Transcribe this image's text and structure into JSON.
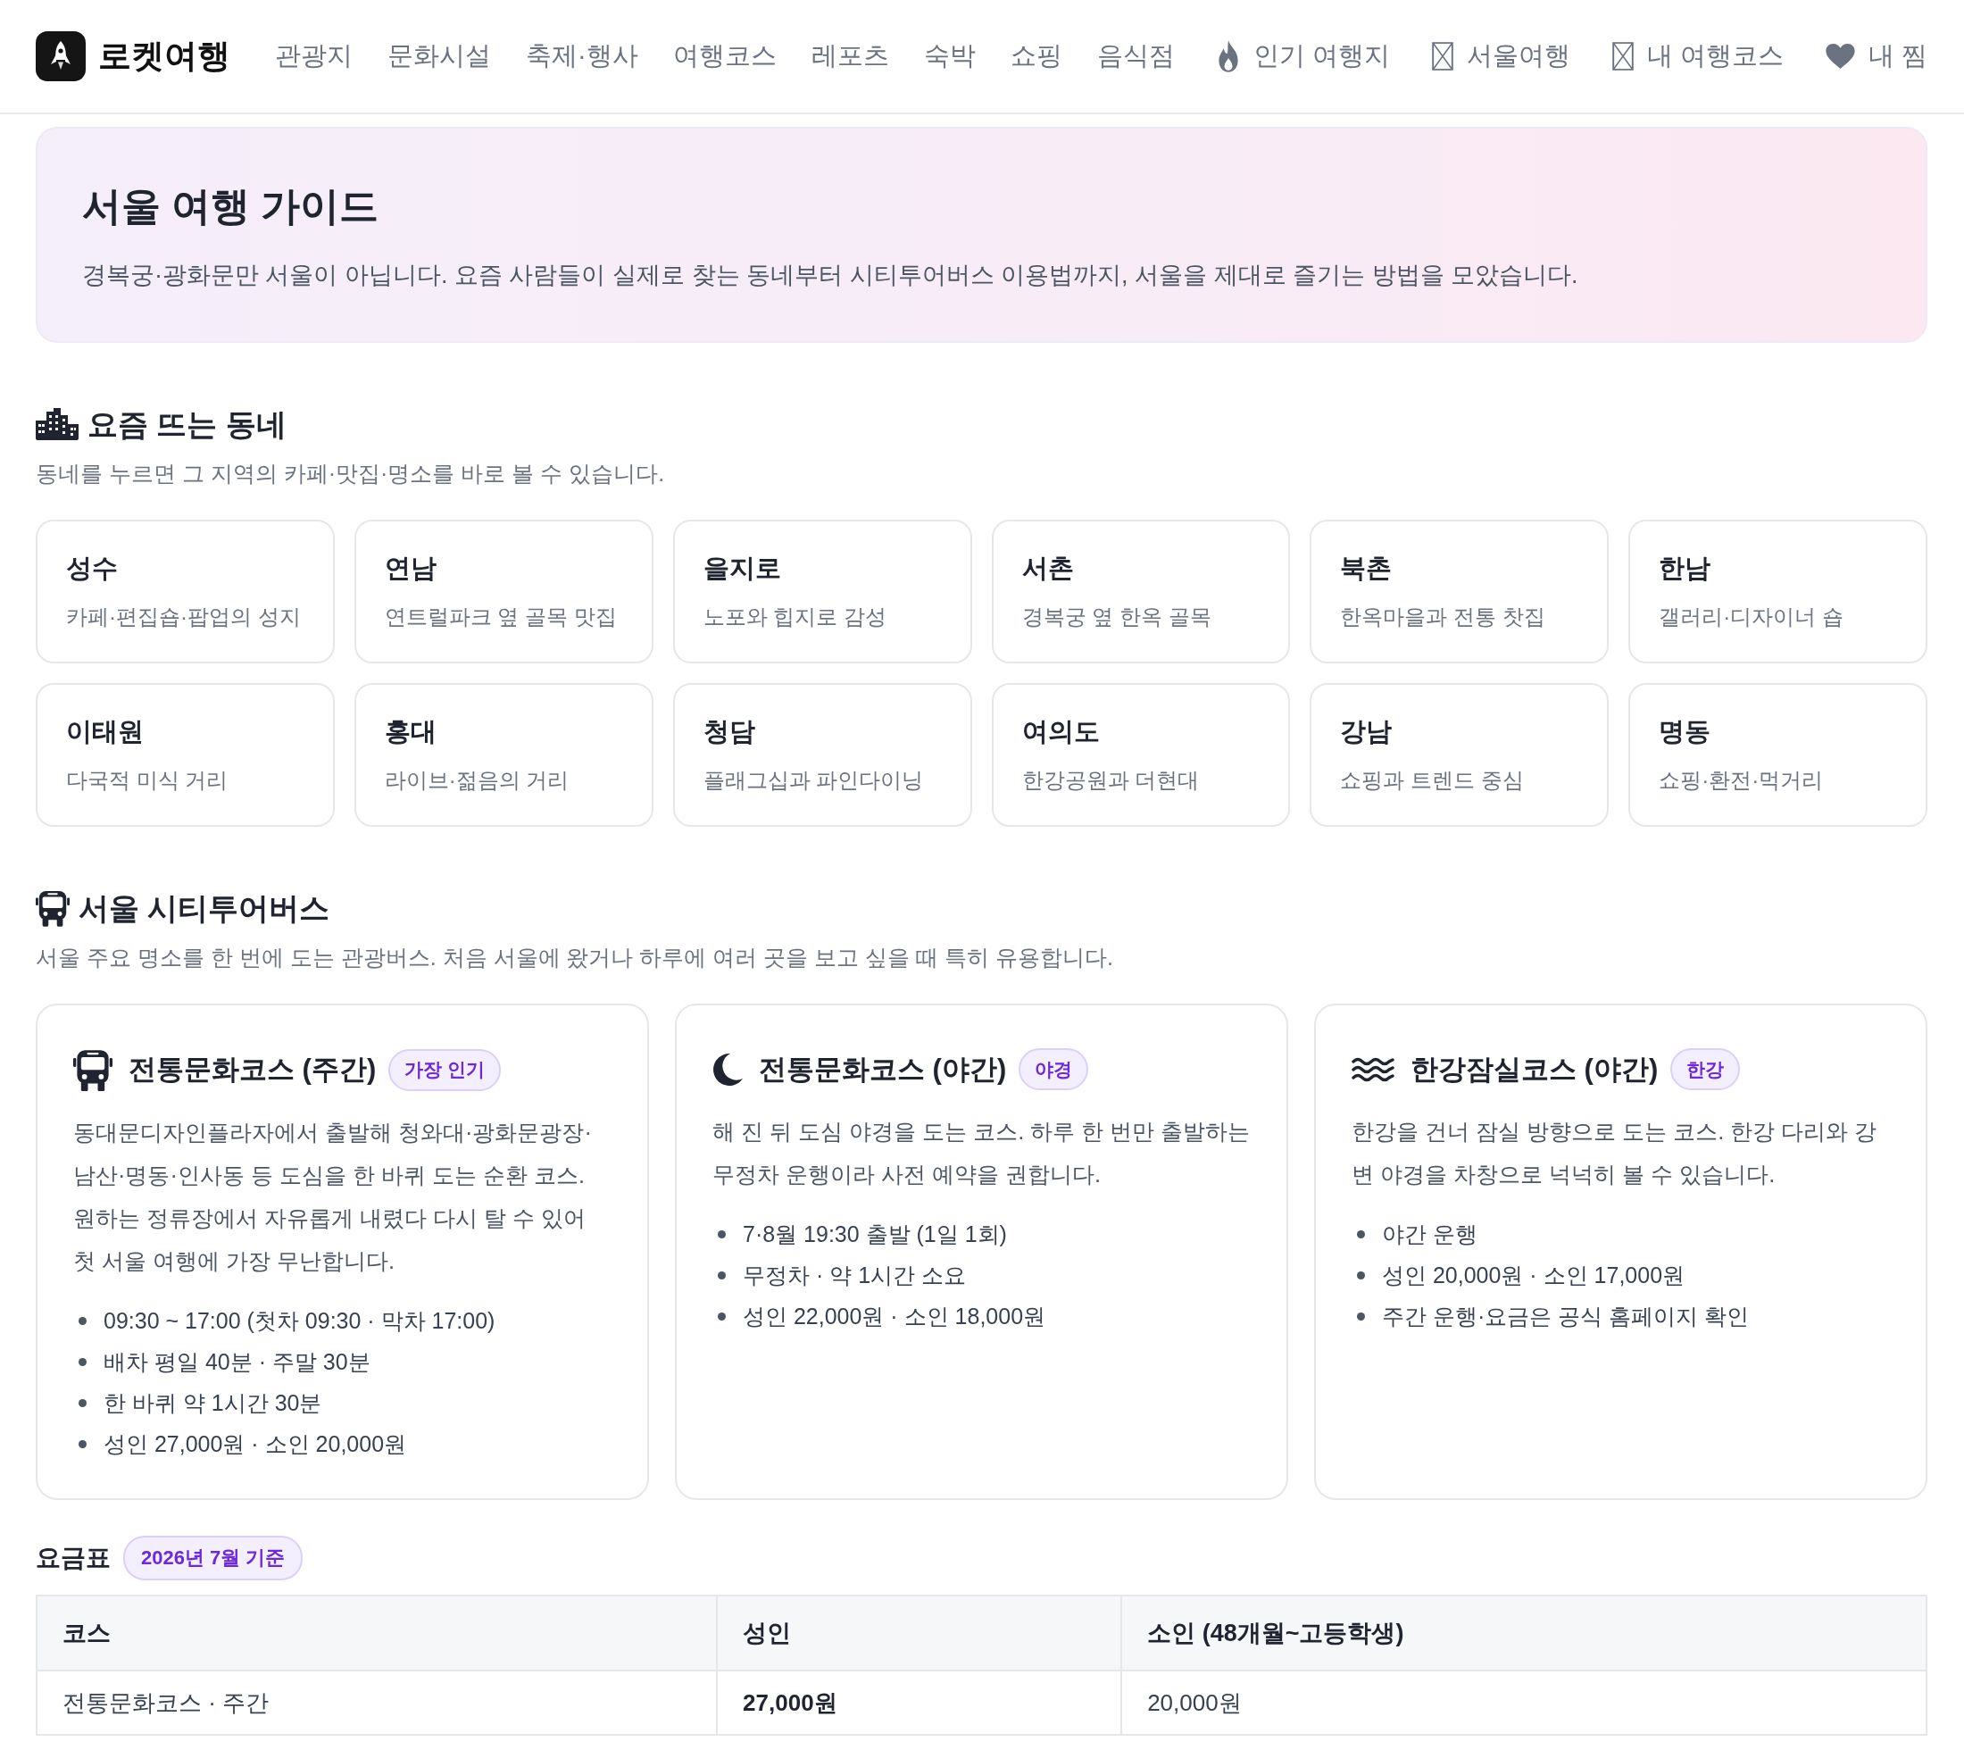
{
  "header": {
    "brand": "로켓여행",
    "nav": [
      {
        "kind": "plain",
        "label": "관광지"
      },
      {
        "kind": "plain",
        "label": "문화시설"
      },
      {
        "kind": "plain",
        "label": "축제·행사"
      },
      {
        "kind": "plain",
        "label": "여행코스"
      },
      {
        "kind": "plain",
        "label": "레포츠"
      },
      {
        "kind": "plain",
        "label": "숙박"
      },
      {
        "kind": "plain",
        "label": "쇼핑"
      },
      {
        "kind": "plain",
        "label": "음식점"
      },
      {
        "kind": "fire",
        "label": "인기 여행지"
      },
      {
        "kind": "box",
        "label": "서울여행"
      },
      {
        "kind": "box",
        "label": "내 여행코스"
      },
      {
        "kind": "heart",
        "label": "내 찜"
      }
    ]
  },
  "hero": {
    "title": "서울 여행 가이드",
    "description": "경복궁·광화문만 서울이 아닙니다. 요즘 사람들이 실제로 찾는 동네부터 시티투어버스 이용법까지, 서울을 제대로 즐기는 방법을 모았습니다."
  },
  "neighborhoods": {
    "title": "요즘 뜨는 동네",
    "description": "동네를 누르면 그 지역의 카페·맛집·명소를 바로 볼 수 있습니다.",
    "items": [
      {
        "name": "성수",
        "tagline": "카페·편집숍·팝업의 성지"
      },
      {
        "name": "연남",
        "tagline": "연트럴파크 옆 골목 맛집"
      },
      {
        "name": "을지로",
        "tagline": "노포와 힙지로 감성"
      },
      {
        "name": "서촌",
        "tagline": "경복궁 옆 한옥 골목"
      },
      {
        "name": "북촌",
        "tagline": "한옥마을과 전통 찻집"
      },
      {
        "name": "한남",
        "tagline": "갤러리·디자이너 숍"
      },
      {
        "name": "이태원",
        "tagline": "다국적 미식 거리"
      },
      {
        "name": "홍대",
        "tagline": "라이브·젊음의 거리"
      },
      {
        "name": "청담",
        "tagline": "플래그십과 파인다이닝"
      },
      {
        "name": "여의도",
        "tagline": "한강공원과 더현대"
      },
      {
        "name": "강남",
        "tagline": "쇼핑과 트렌드 중심"
      },
      {
        "name": "명동",
        "tagline": "쇼핑·환전·먹거리"
      }
    ]
  },
  "city_tour": {
    "title": "서울 시티투어버스",
    "description": "서울 주요 명소를 한 번에 도는 관광버스. 처음 서울에 왔거나 하루에 여러 곳을 보고 싶을 때 특히 유용합니다.",
    "courses": [
      {
        "kind": "day",
        "title": "전통문화코스 (주간)",
        "badge": "가장 인기",
        "description": "동대문디자인플라자에서 출발해 청와대·광화문광장·남산·명동·인사동 등 도심을 한 바퀴 도는 순환 코스. 원하는 정류장에서 자유롭게 내렸다 다시 탈 수 있어 첫 서울 여행에 가장 무난합니다.",
        "details": [
          "09:30 ~ 17:00 (첫차 09:30 · 막차 17:00)",
          "배차 평일 40분 · 주말 30분",
          "한 바퀴 약 1시간 30분",
          "성인 27,000원 · 소인 20,000원"
        ]
      },
      {
        "kind": "night",
        "title": "전통문화코스 (야간)",
        "badge": "야경",
        "description": "해 진 뒤 도심 야경을 도는 코스. 하루 한 번만 출발하는 무정차 운행이라 사전 예약을 권합니다.",
        "details": [
          "7·8월 19:30 출발 (1일 1회)",
          "무정차 · 약 1시간 소요",
          "성인 22,000원 · 소인 18,000원"
        ]
      },
      {
        "kind": "river",
        "title": "한강잠실코스 (야간)",
        "badge": "한강",
        "description": "한강을 건너 잠실 방향으로 도는 코스. 한강 다리와 강변 야경을 차창으로 넉넉히 볼 수 있습니다.",
        "details": [
          "야간 운행",
          "성인 20,000원 · 소인 17,000원",
          "주간 운행·요금은 공식 홈페이지 확인"
        ]
      }
    ]
  },
  "fares": {
    "title": "요금표",
    "badge": "2026년 7월 기준",
    "columns": [
      "코스",
      "성인",
      "소인 (48개월~고등학생)"
    ],
    "rows": [
      {
        "course": "전통문화코스 · 주간",
        "adult": "27,000원",
        "child": "20,000원"
      }
    ]
  }
}
